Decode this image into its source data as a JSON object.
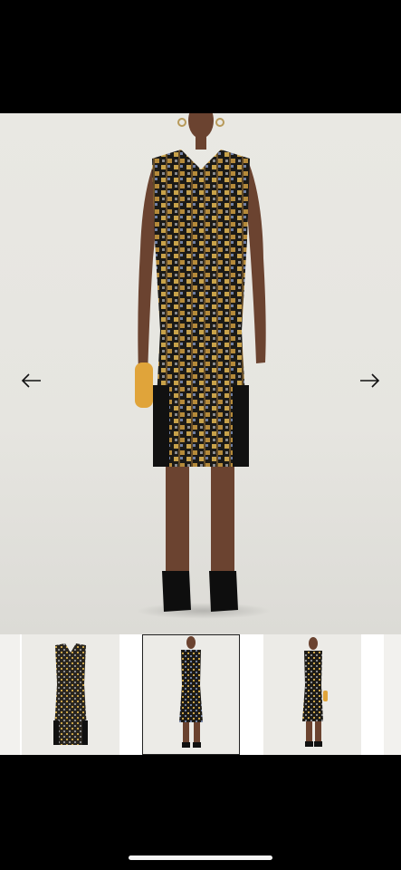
{
  "gallery": {
    "prev_icon": "arrow-left-icon",
    "next_icon": "arrow-right-icon",
    "selected_index": 1,
    "thumbnail_count": 3
  },
  "colors": {
    "background": "#e8e7e2",
    "dress_base": "#1b1a17",
    "pattern_gold": "#c8a24a",
    "pattern_blue": "#6f7fa3",
    "clutch": "#e0a43a"
  }
}
